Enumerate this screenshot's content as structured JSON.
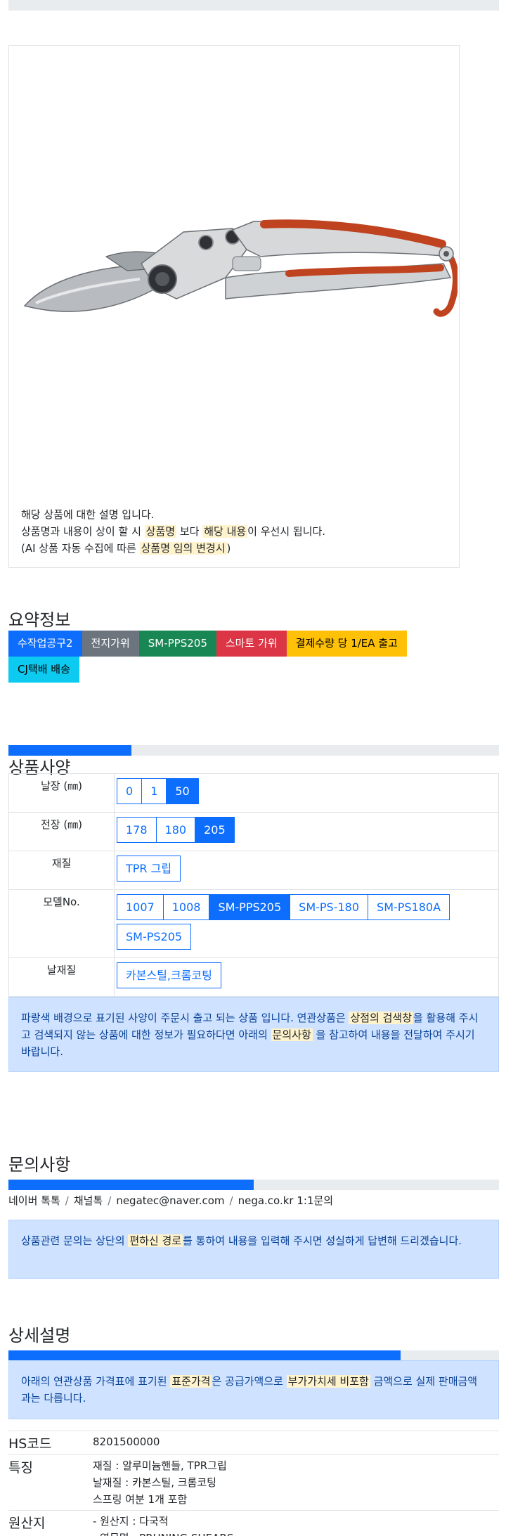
{
  "product": {
    "desc_line1": "해당 상품에 대한 설명 입니다.",
    "desc_line2_a": "상품명과 내용이 상이 할 시 ",
    "desc_line2_hl1": "상품명",
    "desc_line2_b": " 보다 ",
    "desc_line2_hl2": "해당 내용",
    "desc_line2_c": "이 우선시 됩니다.",
    "desc_line3_a": "(AI 상품 자동 수집에 따른 ",
    "desc_line3_hl": "상품명 임의 변경시",
    "desc_line3_b": ")"
  },
  "summary": {
    "title": "요약정보",
    "badges": [
      {
        "label": "수작업공구2",
        "bg": "#0d6efd",
        "fg": "#ffffff"
      },
      {
        "label": "전지가위",
        "bg": "#6c757d",
        "fg": "#ffffff"
      },
      {
        "label": "SM-PPS205",
        "bg": "#198754",
        "fg": "#ffffff"
      },
      {
        "label": "스마토 가위",
        "bg": "#dc3545",
        "fg": "#ffffff"
      },
      {
        "label": "결제수량 당 1/EA 출고",
        "bg": "#ffc107",
        "fg": "#000000"
      },
      {
        "label": "CJ택배 배송",
        "bg": "#0dcaf0",
        "fg": "#000000"
      }
    ]
  },
  "spec": {
    "title": "상품사양",
    "progress": 0.25,
    "rows": [
      {
        "key": "날장 (㎜)",
        "options": [
          "0",
          "1",
          "50"
        ],
        "active": 2
      },
      {
        "key": "전장 (㎜)",
        "options": [
          "178",
          "180",
          "205"
        ],
        "active": 2
      },
      {
        "key": "재질",
        "options": [
          "TPR 그립"
        ],
        "active": -1
      },
      {
        "key": "모델No.",
        "options": [
          "1007",
          "1008",
          "SM-PPS205",
          "SM-PS-180",
          "SM-PS180A",
          "SM-PS205"
        ],
        "active": 2
      },
      {
        "key": "날재질",
        "options": [
          "카본스틸,크롬코팅"
        ],
        "active": -1
      }
    ],
    "notice_a": "파랑색 배경으로 표기된 사양이 주문시 출고 되는 상품 입니다. 연관상품은 ",
    "notice_hl1": "상점의 검색창",
    "notice_b": "을 활용해 주시고 검색되지 않는 상품에 대한 정보가 필요하다면 아래의 ",
    "notice_hl2": "문의사항",
    "notice_c": " 을 참고하여 내용을 전달하여 주시기 바랍니다."
  },
  "inquiry": {
    "title": "문의사항",
    "progress": 0.5,
    "contacts": [
      "네이버 톡톡",
      "채널톡",
      "negatec@naver.com",
      "nega.co.kr 1:1문의"
    ],
    "separator": "/",
    "notice_a": "상품관련 문의는 상단의 ",
    "notice_hl": "편하신 경로",
    "notice_b": "를 통하여 내용을 입력해 주시면 성실하게 답변해 드리겠습니다."
  },
  "detail": {
    "title": "상세설명",
    "progress": 0.8,
    "notice_a": "아래의 연관상품 가격표에 표기된 ",
    "notice_hl1": "표준가격",
    "notice_b": "은 공급가액으로 ",
    "notice_hl2": "부가가치세 비포함",
    "notice_c": " 금액으로 실제 판매금액과는 다릅니다.",
    "rows": [
      {
        "key": "HS코드",
        "lines": [
          "8201500000"
        ]
      },
      {
        "key": "특징",
        "lines": [
          "재질 : 알루미늄핸들, TPR그립",
          "날재질 : 카본스틸, 크롬코팅",
          "스프링 여분 1개 포함"
        ]
      },
      {
        "key": "원산지",
        "lines": [
          "- 원산지 : 다국적",
          "- 영문명 : PRUNING SHEARS"
        ]
      }
    ]
  }
}
